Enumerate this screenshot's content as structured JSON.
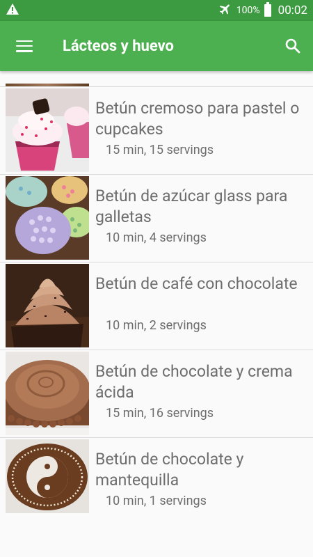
{
  "status_bar": {
    "battery_percent": "100%",
    "time": "00:02"
  },
  "app_bar": {
    "title": "Lácteos y huevo"
  },
  "recipes": [
    {
      "title": "Betún cremoso para pastel o cupcakes",
      "meta": "15 min, 15 servings",
      "image": "cupcakes-photo"
    },
    {
      "title": "Betún de azúcar glass para galletas",
      "meta": "10 min, 4 servings",
      "image": "decorated-cookies-photo"
    },
    {
      "title": "Betún de café con chocolate",
      "meta": "10 min, 2 servings",
      "image": "chocolate-cupcake-photo"
    },
    {
      "title": "Betún de chocolate y crema ácida",
      "meta": "15 min, 16 servings",
      "image": "chocolate-cake-photo"
    },
    {
      "title": "Betún de chocolate y mantequilla",
      "meta": "10 min, 1 servings",
      "image": "yin-yang-cake-photo"
    }
  ]
}
